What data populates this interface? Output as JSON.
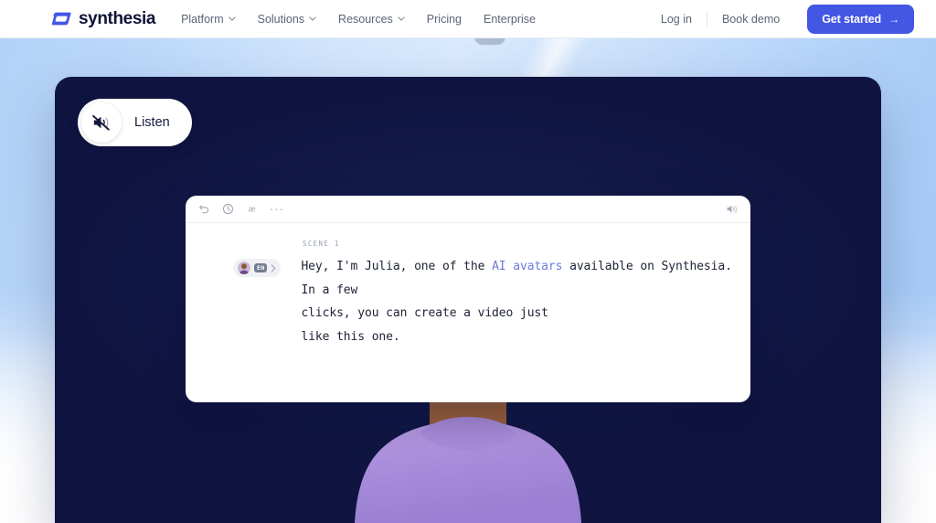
{
  "nav": {
    "brand": "synthesia",
    "brand_icon": "synthesia-speech-bubble-logo",
    "links": [
      {
        "label": "Platform",
        "has_dropdown": true,
        "icon": "chevron-down-icon"
      },
      {
        "label": "Solutions",
        "has_dropdown": true,
        "icon": "chevron-down-icon"
      },
      {
        "label": "Resources",
        "has_dropdown": true,
        "icon": "chevron-down-icon"
      },
      {
        "label": "Pricing",
        "has_dropdown": false,
        "icon": ""
      },
      {
        "label": "Enterprise",
        "has_dropdown": false,
        "icon": ""
      }
    ],
    "login_label": "Log in",
    "book_demo_label": "Book demo",
    "cta_label": "Get started",
    "cta_arrow": "→",
    "cta_color": "#4356e4"
  },
  "hero": {
    "listen": {
      "label": "Listen",
      "icon": "speaker-muted-icon"
    },
    "video_panel_color": "#0f1440"
  },
  "script_editor": {
    "toolbar": {
      "icons": [
        {
          "name": "undo-icon"
        },
        {
          "name": "clock-icon"
        },
        {
          "name": "pronunciation-ae-icon"
        },
        {
          "name": "more-options-icon"
        }
      ],
      "more_glyph": "···",
      "right_icon": {
        "name": "volume-icon"
      }
    },
    "scene_label": "SCENE 1",
    "speaker": {
      "avatar_icon": "speaker-avatar-thumbnail",
      "language_badge": "EN",
      "chevron_icon": "chevron-right-icon"
    },
    "script_before_link": "Hey, I'm Julia, one of the ",
    "script_link_1": "AI",
    "script_link_2": "avatars",
    "script_after_link": " available on Synthesia. In a few\nclicks, you can create a video just\nlike this one.",
    "link_color": "#6b7ae0"
  }
}
